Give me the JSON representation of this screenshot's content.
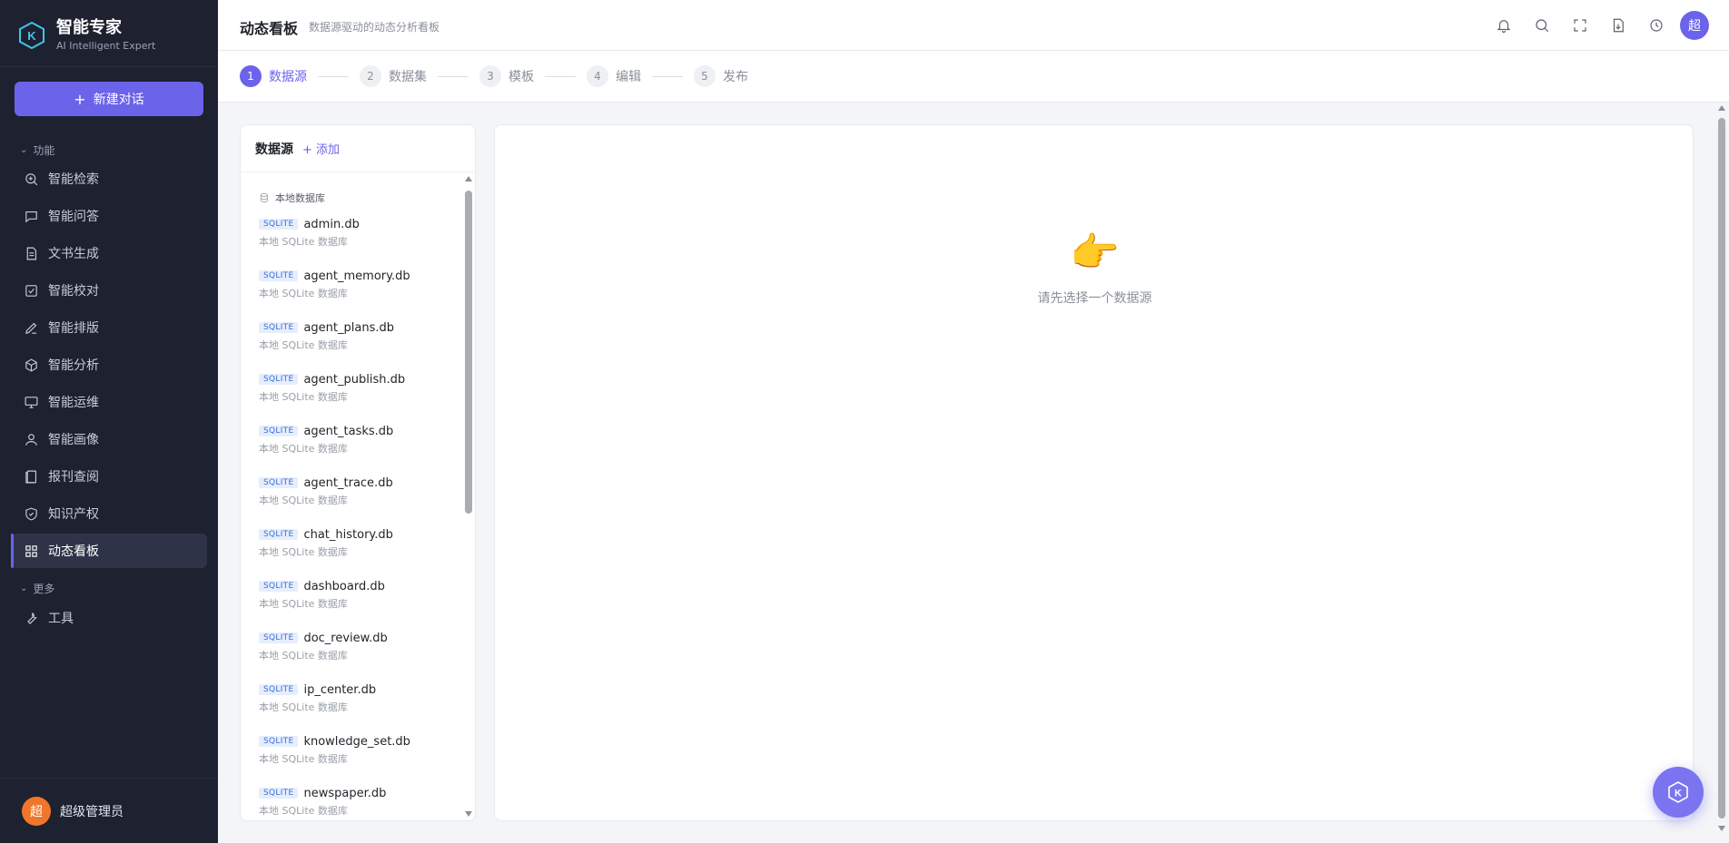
{
  "brand": {
    "title": "智能专家",
    "subtitle": "AI Intelligent Expert",
    "logo_letter": "K"
  },
  "sidebar": {
    "new_chat_label": "新建对话",
    "section_features": "功能",
    "section_more": "更多",
    "items": [
      {
        "label": "智能检索",
        "icon": "search-icon"
      },
      {
        "label": "智能问答",
        "icon": "chat-icon"
      },
      {
        "label": "文书生成",
        "icon": "document-icon"
      },
      {
        "label": "智能校对",
        "icon": "checkbox-icon"
      },
      {
        "label": "智能排版",
        "icon": "pen-icon"
      },
      {
        "label": "智能分析",
        "icon": "cube-icon"
      },
      {
        "label": "智能运维",
        "icon": "monitor-icon"
      },
      {
        "label": "智能画像",
        "icon": "user-icon"
      },
      {
        "label": "报刊查阅",
        "icon": "book-icon"
      },
      {
        "label": "知识产权",
        "icon": "shield-icon"
      },
      {
        "label": "动态看板",
        "icon": "grid-icon",
        "active": true
      }
    ],
    "more_items": [
      {
        "label": "工具",
        "icon": "wrench-icon"
      }
    ],
    "user": {
      "avatar_letter": "超",
      "name": "超级管理员"
    }
  },
  "header": {
    "title": "动态看板",
    "subtitle": "数据源驱动的动态分析看板",
    "avatar_letter": "超"
  },
  "steps": [
    {
      "num": "1",
      "label": "数据源",
      "active": true
    },
    {
      "num": "2",
      "label": "数据集"
    },
    {
      "num": "3",
      "label": "模板"
    },
    {
      "num": "4",
      "label": "编辑"
    },
    {
      "num": "5",
      "label": "发布"
    }
  ],
  "datasource_panel": {
    "title": "数据源",
    "add_label": "+ 添加",
    "group_label": "本地数据库",
    "items": [
      {
        "badge": "SQLITE",
        "name": "admin.db",
        "desc": "本地 SQLite 数据库"
      },
      {
        "badge": "SQLITE",
        "name": "agent_memory.db",
        "desc": "本地 SQLite 数据库"
      },
      {
        "badge": "SQLITE",
        "name": "agent_plans.db",
        "desc": "本地 SQLite 数据库"
      },
      {
        "badge": "SQLITE",
        "name": "agent_publish.db",
        "desc": "本地 SQLite 数据库"
      },
      {
        "badge": "SQLITE",
        "name": "agent_tasks.db",
        "desc": "本地 SQLite 数据库"
      },
      {
        "badge": "SQLITE",
        "name": "agent_trace.db",
        "desc": "本地 SQLite 数据库"
      },
      {
        "badge": "SQLITE",
        "name": "chat_history.db",
        "desc": "本地 SQLite 数据库"
      },
      {
        "badge": "SQLITE",
        "name": "dashboard.db",
        "desc": "本地 SQLite 数据库"
      },
      {
        "badge": "SQLITE",
        "name": "doc_review.db",
        "desc": "本地 SQLite 数据库"
      },
      {
        "badge": "SQLITE",
        "name": "ip_center.db",
        "desc": "本地 SQLite 数据库"
      },
      {
        "badge": "SQLITE",
        "name": "knowledge_set.db",
        "desc": "本地 SQLite 数据库"
      },
      {
        "badge": "SQLITE",
        "name": "newspaper.db",
        "desc": "本地 SQLite 数据库"
      }
    ]
  },
  "main": {
    "empty_emoji": "👉",
    "empty_text": "请先选择一个数据源"
  },
  "colors": {
    "accent": "#6b63ea",
    "sidebar_bg": "#1e2130",
    "badge_text": "#3a6fd8"
  }
}
